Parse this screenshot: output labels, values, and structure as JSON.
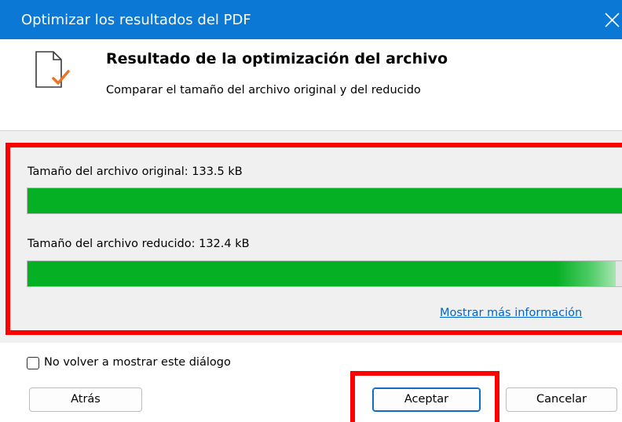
{
  "dialog": {
    "title": "Optimizar los resultados del PDF",
    "close_icon": "close-icon"
  },
  "header": {
    "icon": "document-check-icon",
    "title": "Resultado de la optimización del archivo",
    "subtitle": "Comparar el tamaño del archivo original y del reducido"
  },
  "sizes": {
    "original_label": "Tamaño del archivo original: 133.5 kB",
    "original_fill_fraction": 1.0,
    "reduced_label": "Tamaño del archivo reducido: 132.4 kB",
    "reduced_fill_fraction": 0.99,
    "fill_color": "#06b025"
  },
  "more_info_link": "Mostrar más información",
  "dont_show_again": {
    "label": "No volver a mostrar este diálogo",
    "checked": false
  },
  "buttons": {
    "back": "Atrás",
    "accept": "Aceptar",
    "cancel": "Cancelar"
  },
  "colors": {
    "titlebar": "#0a78d4",
    "highlight": "#ff0000",
    "link": "#0066cc"
  }
}
